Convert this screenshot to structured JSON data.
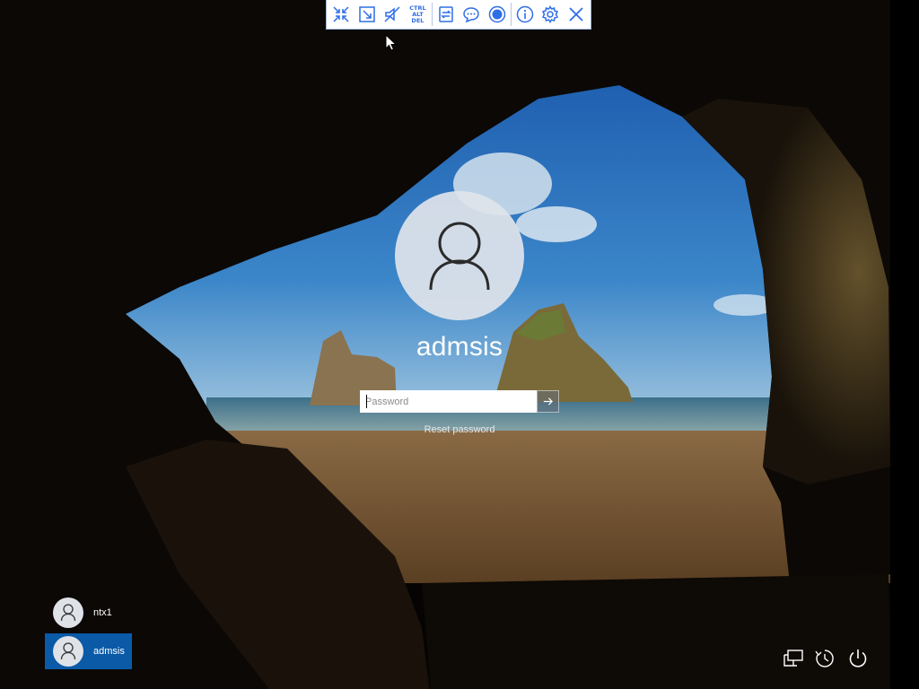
{
  "toolbar": {
    "buttons": [
      {
        "name": "fullscreen-icon"
      },
      {
        "name": "fit-screen-icon"
      },
      {
        "name": "mute-audio-icon"
      },
      {
        "name": "ctrl-alt-del-icon",
        "label_lines": [
          "CTRL",
          "ALT",
          "DEL"
        ]
      },
      {
        "name": "switch-display-icon"
      },
      {
        "name": "chat-icon"
      },
      {
        "name": "record-icon"
      },
      {
        "name": "info-icon"
      },
      {
        "name": "settings-icon"
      },
      {
        "name": "close-icon"
      }
    ],
    "accent": "#2e6ee6"
  },
  "login": {
    "username": "admsis",
    "password_placeholder": "Password",
    "password_value": "",
    "reset_password_label": "Reset password",
    "submit_icon": "arrow-right-icon"
  },
  "user_tiles": [
    {
      "name": "ntx1",
      "selected": false
    },
    {
      "name": "admsis",
      "selected": true
    }
  ],
  "system_icons": [
    "network-icon",
    "accessibility-icon",
    "power-icon"
  ],
  "colors": {
    "selected_tile": "#0a5aa8",
    "sky": "#2b6cb8",
    "sand": "#7a5a35"
  }
}
